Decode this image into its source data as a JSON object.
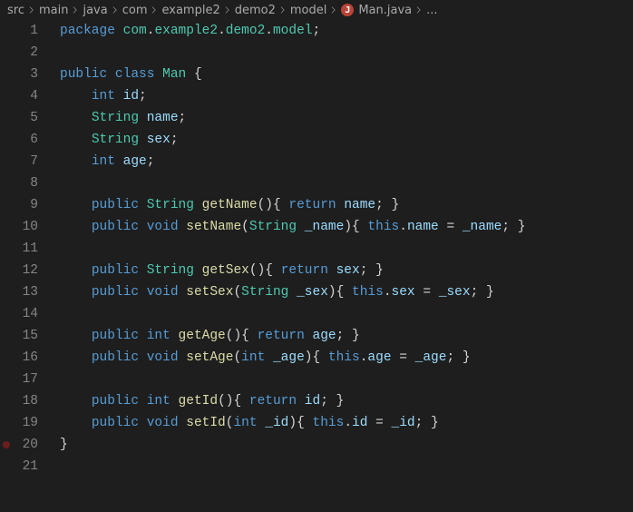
{
  "breadcrumb": {
    "items": [
      "src",
      "main",
      "java",
      "com",
      "example2",
      "demo2",
      "model"
    ],
    "file": "Man.java",
    "trailing_ellipsis": "..."
  },
  "editor": {
    "breakpoint_lines": [
      20
    ],
    "lines": [
      {
        "n": 1,
        "tokens": [
          [
            "t-kw",
            "package"
          ],
          [
            "t-plain",
            " "
          ],
          [
            "t-ns",
            "com"
          ],
          [
            "t-punc",
            "."
          ],
          [
            "t-ns",
            "example2"
          ],
          [
            "t-punc",
            "."
          ],
          [
            "t-ns",
            "demo2"
          ],
          [
            "t-punc",
            "."
          ],
          [
            "t-ns",
            "model"
          ],
          [
            "t-punc",
            ";"
          ]
        ]
      },
      {
        "n": 2,
        "tokens": []
      },
      {
        "n": 3,
        "tokens": [
          [
            "t-kw",
            "public"
          ],
          [
            "t-plain",
            " "
          ],
          [
            "t-kw",
            "class"
          ],
          [
            "t-plain",
            " "
          ],
          [
            "t-type",
            "Man"
          ],
          [
            "t-plain",
            " "
          ],
          [
            "t-punc",
            "{"
          ]
        ]
      },
      {
        "n": 4,
        "tokens": [
          [
            "t-plain",
            "    "
          ],
          [
            "t-kw",
            "int"
          ],
          [
            "t-plain",
            " "
          ],
          [
            "t-var",
            "id"
          ],
          [
            "t-punc",
            ";"
          ]
        ]
      },
      {
        "n": 5,
        "tokens": [
          [
            "t-plain",
            "    "
          ],
          [
            "t-type",
            "String"
          ],
          [
            "t-plain",
            " "
          ],
          [
            "t-var",
            "name"
          ],
          [
            "t-punc",
            ";"
          ]
        ]
      },
      {
        "n": 6,
        "tokens": [
          [
            "t-plain",
            "    "
          ],
          [
            "t-type",
            "String"
          ],
          [
            "t-plain",
            " "
          ],
          [
            "t-var",
            "sex"
          ],
          [
            "t-punc",
            ";"
          ]
        ]
      },
      {
        "n": 7,
        "tokens": [
          [
            "t-plain",
            "    "
          ],
          [
            "t-kw",
            "int"
          ],
          [
            "t-plain",
            " "
          ],
          [
            "t-var",
            "age"
          ],
          [
            "t-punc",
            ";"
          ]
        ]
      },
      {
        "n": 8,
        "tokens": []
      },
      {
        "n": 9,
        "tokens": [
          [
            "t-plain",
            "    "
          ],
          [
            "t-kw",
            "public"
          ],
          [
            "t-plain",
            " "
          ],
          [
            "t-type",
            "String"
          ],
          [
            "t-plain",
            " "
          ],
          [
            "t-fn",
            "getName"
          ],
          [
            "t-punc",
            "(){"
          ],
          [
            "t-plain",
            " "
          ],
          [
            "t-kw",
            "return"
          ],
          [
            "t-plain",
            " "
          ],
          [
            "t-var",
            "name"
          ],
          [
            "t-punc",
            "; }"
          ]
        ]
      },
      {
        "n": 10,
        "tokens": [
          [
            "t-plain",
            "    "
          ],
          [
            "t-kw",
            "public"
          ],
          [
            "t-plain",
            " "
          ],
          [
            "t-kw",
            "void"
          ],
          [
            "t-plain",
            " "
          ],
          [
            "t-fn",
            "setName"
          ],
          [
            "t-punc",
            "("
          ],
          [
            "t-type",
            "String"
          ],
          [
            "t-plain",
            " "
          ],
          [
            "t-var",
            "_name"
          ],
          [
            "t-punc",
            "){"
          ],
          [
            "t-plain",
            " "
          ],
          [
            "t-kw",
            "this"
          ],
          [
            "t-punc",
            "."
          ],
          [
            "t-var",
            "name"
          ],
          [
            "t-plain",
            " "
          ],
          [
            "t-punc",
            "="
          ],
          [
            "t-plain",
            " "
          ],
          [
            "t-var",
            "_name"
          ],
          [
            "t-punc",
            "; }"
          ]
        ]
      },
      {
        "n": 11,
        "tokens": []
      },
      {
        "n": 12,
        "tokens": [
          [
            "t-plain",
            "    "
          ],
          [
            "t-kw",
            "public"
          ],
          [
            "t-plain",
            " "
          ],
          [
            "t-type",
            "String"
          ],
          [
            "t-plain",
            " "
          ],
          [
            "t-fn",
            "getSex"
          ],
          [
            "t-punc",
            "(){"
          ],
          [
            "t-plain",
            " "
          ],
          [
            "t-kw",
            "return"
          ],
          [
            "t-plain",
            " "
          ],
          [
            "t-var",
            "sex"
          ],
          [
            "t-punc",
            "; }"
          ]
        ]
      },
      {
        "n": 13,
        "tokens": [
          [
            "t-plain",
            "    "
          ],
          [
            "t-kw",
            "public"
          ],
          [
            "t-plain",
            " "
          ],
          [
            "t-kw",
            "void"
          ],
          [
            "t-plain",
            " "
          ],
          [
            "t-fn",
            "setSex"
          ],
          [
            "t-punc",
            "("
          ],
          [
            "t-type",
            "String"
          ],
          [
            "t-plain",
            " "
          ],
          [
            "t-var",
            "_sex"
          ],
          [
            "t-punc",
            "){"
          ],
          [
            "t-plain",
            " "
          ],
          [
            "t-kw",
            "this"
          ],
          [
            "t-punc",
            "."
          ],
          [
            "t-var",
            "sex"
          ],
          [
            "t-plain",
            " "
          ],
          [
            "t-punc",
            "="
          ],
          [
            "t-plain",
            " "
          ],
          [
            "t-var",
            "_sex"
          ],
          [
            "t-punc",
            "; }"
          ]
        ]
      },
      {
        "n": 14,
        "tokens": []
      },
      {
        "n": 15,
        "tokens": [
          [
            "t-plain",
            "    "
          ],
          [
            "t-kw",
            "public"
          ],
          [
            "t-plain",
            " "
          ],
          [
            "t-kw",
            "int"
          ],
          [
            "t-plain",
            " "
          ],
          [
            "t-fn",
            "getAge"
          ],
          [
            "t-punc",
            "(){"
          ],
          [
            "t-plain",
            " "
          ],
          [
            "t-kw",
            "return"
          ],
          [
            "t-plain",
            " "
          ],
          [
            "t-var",
            "age"
          ],
          [
            "t-punc",
            "; }"
          ]
        ]
      },
      {
        "n": 16,
        "tokens": [
          [
            "t-plain",
            "    "
          ],
          [
            "t-kw",
            "public"
          ],
          [
            "t-plain",
            " "
          ],
          [
            "t-kw",
            "void"
          ],
          [
            "t-plain",
            " "
          ],
          [
            "t-fn",
            "setAge"
          ],
          [
            "t-punc",
            "("
          ],
          [
            "t-kw",
            "int"
          ],
          [
            "t-plain",
            " "
          ],
          [
            "t-var",
            "_age"
          ],
          [
            "t-punc",
            "){"
          ],
          [
            "t-plain",
            " "
          ],
          [
            "t-kw",
            "this"
          ],
          [
            "t-punc",
            "."
          ],
          [
            "t-var",
            "age"
          ],
          [
            "t-plain",
            " "
          ],
          [
            "t-punc",
            "="
          ],
          [
            "t-plain",
            " "
          ],
          [
            "t-var",
            "_age"
          ],
          [
            "t-punc",
            "; }"
          ]
        ]
      },
      {
        "n": 17,
        "tokens": []
      },
      {
        "n": 18,
        "tokens": [
          [
            "t-plain",
            "    "
          ],
          [
            "t-kw",
            "public"
          ],
          [
            "t-plain",
            " "
          ],
          [
            "t-kw",
            "int"
          ],
          [
            "t-plain",
            " "
          ],
          [
            "t-fn",
            "getId"
          ],
          [
            "t-punc",
            "(){"
          ],
          [
            "t-plain",
            " "
          ],
          [
            "t-kw",
            "return"
          ],
          [
            "t-plain",
            " "
          ],
          [
            "t-var",
            "id"
          ],
          [
            "t-punc",
            "; }"
          ]
        ]
      },
      {
        "n": 19,
        "tokens": [
          [
            "t-plain",
            "    "
          ],
          [
            "t-kw",
            "public"
          ],
          [
            "t-plain",
            " "
          ],
          [
            "t-kw",
            "void"
          ],
          [
            "t-plain",
            " "
          ],
          [
            "t-fn",
            "setId"
          ],
          [
            "t-punc",
            "("
          ],
          [
            "t-kw",
            "int"
          ],
          [
            "t-plain",
            " "
          ],
          [
            "t-var",
            "_id"
          ],
          [
            "t-punc",
            "){"
          ],
          [
            "t-plain",
            " "
          ],
          [
            "t-kw",
            "this"
          ],
          [
            "t-punc",
            "."
          ],
          [
            "t-var",
            "id"
          ],
          [
            "t-plain",
            " "
          ],
          [
            "t-punc",
            "="
          ],
          [
            "t-plain",
            " "
          ],
          [
            "t-var",
            "_id"
          ],
          [
            "t-punc",
            "; }"
          ]
        ]
      },
      {
        "n": 20,
        "tokens": [
          [
            "t-punc",
            "}"
          ]
        ]
      },
      {
        "n": 21,
        "tokens": []
      }
    ]
  }
}
